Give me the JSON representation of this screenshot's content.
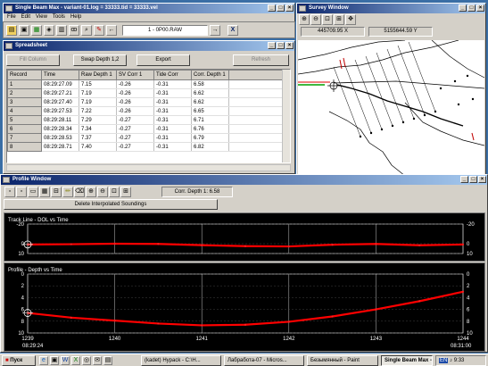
{
  "main_window": {
    "title": "Single Beam Max - variant-01.log = 33333.tid = 33333.vel",
    "menu": [
      "File",
      "Edit",
      "View",
      "Tools",
      "Help"
    ],
    "file_display": "1 - 0P00.RAW"
  },
  "spreadsheet": {
    "title": "Spreadsheet",
    "buttons": {
      "fill_column": "Fill Column",
      "swap_depth": "Swap Depth 1,2",
      "export": "Export",
      "refresh": "Refresh"
    },
    "columns": [
      "Record",
      "Time",
      "Raw Depth 1",
      "SV Corr 1",
      "Tide Corr",
      "Corr. Depth 1"
    ],
    "rows": [
      [
        "1",
        "08:29:27.09",
        "7.15",
        "-0.26",
        "-0.31",
        "6.58"
      ],
      [
        "2",
        "08:29:27.21",
        "7.19",
        "-0.26",
        "-0.31",
        "6.62"
      ],
      [
        "3",
        "08:29:27.40",
        "7.19",
        "-0.26",
        "-0.31",
        "6.62"
      ],
      [
        "4",
        "08:29:27.53",
        "7.22",
        "-0.26",
        "-0.31",
        "6.65"
      ],
      [
        "5",
        "08:29:28.11",
        "7.29",
        "-0.27",
        "-0.31",
        "6.71"
      ],
      [
        "6",
        "08:29:28.34",
        "7.34",
        "-0.27",
        "-0.31",
        "6.76"
      ],
      [
        "7",
        "08:29:28.53",
        "7.37",
        "-0.27",
        "-0.31",
        "6.79"
      ],
      [
        "8",
        "08:29:28.71",
        "7.40",
        "-0.27",
        "-0.31",
        "6.82"
      ]
    ]
  },
  "survey": {
    "title": "Survey Window",
    "x_coord": "445709.95 X",
    "y_coord": "5155644.59 Y"
  },
  "profile": {
    "title": "Profile Window",
    "corr_depth": "Corr. Depth 1: 6.58",
    "delete_button": "Delete Interpolated Soundings",
    "track_title": "Track Line - DOL vs Time",
    "track_left_ticks": [
      "-20",
      "0",
      "10"
    ],
    "track_right_ticks": [
      "-20",
      "0",
      "10"
    ],
    "depth_title": "Profile - Depth vs Time",
    "depth_ticks": [
      "0",
      "2",
      "4",
      "6",
      "8",
      "10"
    ],
    "x_ticks": [
      "1239",
      "1240",
      "1241",
      "1242",
      "1243",
      "1244"
    ],
    "start_time": "08:29:24",
    "end_time": "08:31:00"
  },
  "chart_data": [
    {
      "type": "line",
      "title": "Track Line - DOL vs Time",
      "ylim": [
        -20,
        10
      ],
      "series": [
        {
          "x": [
            1239,
            1239.5,
            1240,
            1240.5,
            1241,
            1241.5,
            1242,
            1242.5,
            1243,
            1243.5,
            1244
          ],
          "values": [
            0.8,
            0.5,
            0.0,
            0.2,
            1.5,
            2.5,
            2.8,
            1.0,
            0.2,
            1.6,
            0.8
          ]
        }
      ]
    },
    {
      "type": "line",
      "title": "Profile - Depth vs Time",
      "ylim": [
        0,
        10
      ],
      "series": [
        {
          "x": [
            1239,
            1239.5,
            1240,
            1240.5,
            1241,
            1241.5,
            1242,
            1242.5,
            1243,
            1243.5,
            1244
          ],
          "values": [
            6.6,
            7.4,
            7.9,
            8.4,
            8.7,
            8.6,
            8.1,
            7.2,
            6.0,
            4.6,
            3.0
          ]
        }
      ]
    }
  ],
  "taskbar": {
    "start": "Пуск",
    "items": [
      "(kadet) Hypack - C:\\H...",
      "Лабработа-07 - Micros...",
      "Безымянный - Paint",
      "Single Beam Max - v..."
    ],
    "lang": "EN",
    "clock": "9:33"
  },
  "colors": {
    "title_active": "#0a246a",
    "desktop": "#3a6ea5",
    "plot_line": "#ff0000"
  }
}
